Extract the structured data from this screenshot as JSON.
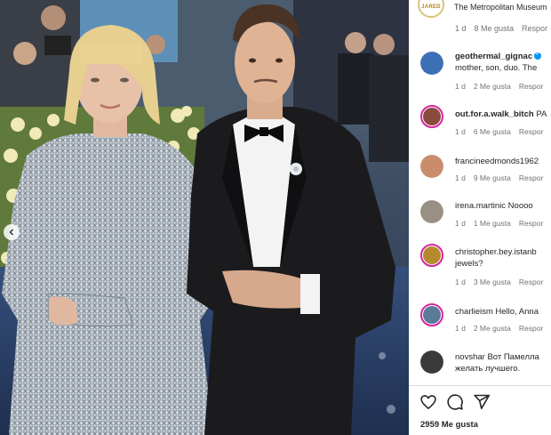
{
  "post": {
    "previous_icon": "chevron-left-icon",
    "likes_label": "2959 Me gusta"
  },
  "header": {
    "avatar_text": "JARED",
    "text": "The Metropolitan Museum"
  },
  "top_meta": {
    "time": "1 d",
    "likes": "8 Me gusta",
    "reply": "Respor"
  },
  "comments": [
    {
      "user": "geothermal_gignac",
      "text": "",
      "line2": "mother, son, duo. The",
      "time": "1 d",
      "likes": "2 Me gusta",
      "reply": "Respor",
      "verified": true,
      "avatar_color": "#3b6fb6",
      "ring": false
    },
    {
      "user": "out.for.a.walk_bitch",
      "text": "PA",
      "line2": "",
      "time": "1 d",
      "likes": "6 Me gusta",
      "reply": "Respor",
      "verified": false,
      "avatar_color": "#8a4a3c",
      "ring": true
    },
    {
      "user": "francineedmonds1962",
      "text": "",
      "line2": "",
      "time": "1 d",
      "likes": "9 Me gusta",
      "reply": "Respor",
      "verified": false,
      "avatar_color": "#c98d6b",
      "ring": false
    },
    {
      "user": "irena.martinic",
      "text": "Noooo",
      "line2": "",
      "time": "1 d",
      "likes": "1 Me gusta",
      "reply": "Respor",
      "verified": false,
      "avatar_color": "#9a8f85",
      "ring": false
    },
    {
      "user": "christopher.bey.istanb",
      "text": "",
      "line2": "jewels?",
      "time": "1 d",
      "likes": "3 Me gusta",
      "reply": "Respor",
      "verified": false,
      "avatar_color": "#b58a2e",
      "ring": true
    },
    {
      "user": "charlieism",
      "text": "Hello, Anna",
      "line2": "",
      "time": "1 d",
      "likes": "2 Me gusta",
      "reply": "Respor",
      "verified": false,
      "avatar_color": "#5a7a9a",
      "ring": true
    },
    {
      "user": "novshar",
      "text": "Вот Памелла",
      "line2": "желать лучшего.",
      "time": "",
      "likes": "",
      "reply": "",
      "verified": false,
      "avatar_color": "#3a3a3a",
      "ring": false
    }
  ],
  "actions": {
    "like_icon": "heart-icon",
    "comment_icon": "comment-icon",
    "share_icon": "share-icon"
  }
}
